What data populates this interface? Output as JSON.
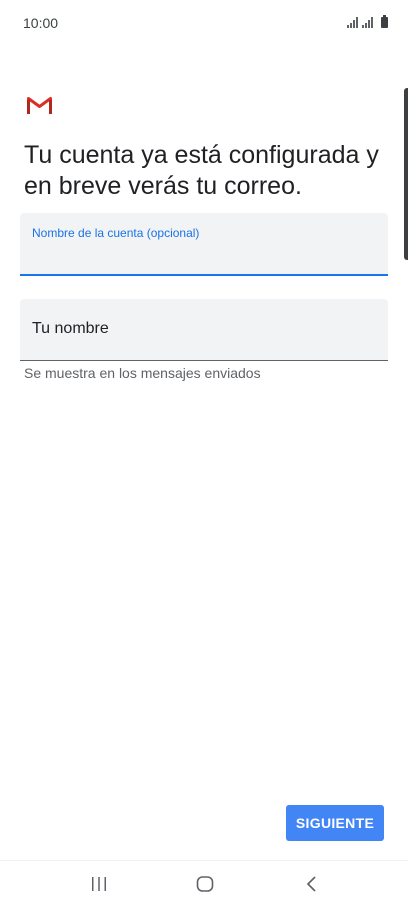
{
  "status_bar": {
    "time": "10:00"
  },
  "colors": {
    "accent": "#1a73e8",
    "button": "#4285f4",
    "gmail_red": "#d93025",
    "field_bg": "#f1f3f4"
  },
  "header": {
    "logo_icon": "gmail-logo",
    "title": "Tu cuenta ya está configurada y en breve verás tu correo."
  },
  "form": {
    "account_name": {
      "label": "Nombre de la cuenta (opcional)",
      "value": ""
    },
    "your_name": {
      "placeholder": "Tu nombre",
      "value": "",
      "helper": "Se muestra en los mensajes enviados"
    }
  },
  "actions": {
    "next_label": "SIGUIENTE"
  },
  "nav_bar": {
    "recents_icon": "recents-icon",
    "home_icon": "home-icon",
    "back_icon": "back-icon"
  }
}
